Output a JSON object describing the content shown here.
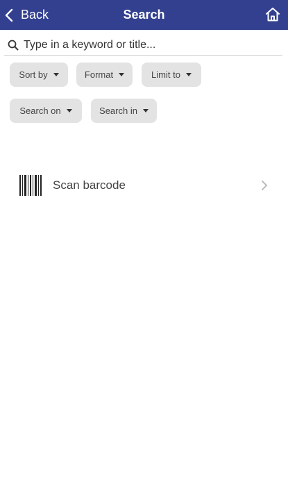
{
  "header": {
    "back_label": "Back",
    "title": "Search",
    "bar_color": "#33408f"
  },
  "search": {
    "placeholder": "Type in a keyword or title..."
  },
  "filters": {
    "sort_by": "Sort by",
    "format": "Format",
    "limit_to": "Limit to",
    "search_on": "Search on",
    "search_in": "Search in"
  },
  "scan": {
    "label": "Scan barcode"
  },
  "icons": [
    "chevron-left-icon",
    "home-icon",
    "search-icon",
    "barcode-icon",
    "chevron-right-icon",
    "caret-down-icon"
  ]
}
